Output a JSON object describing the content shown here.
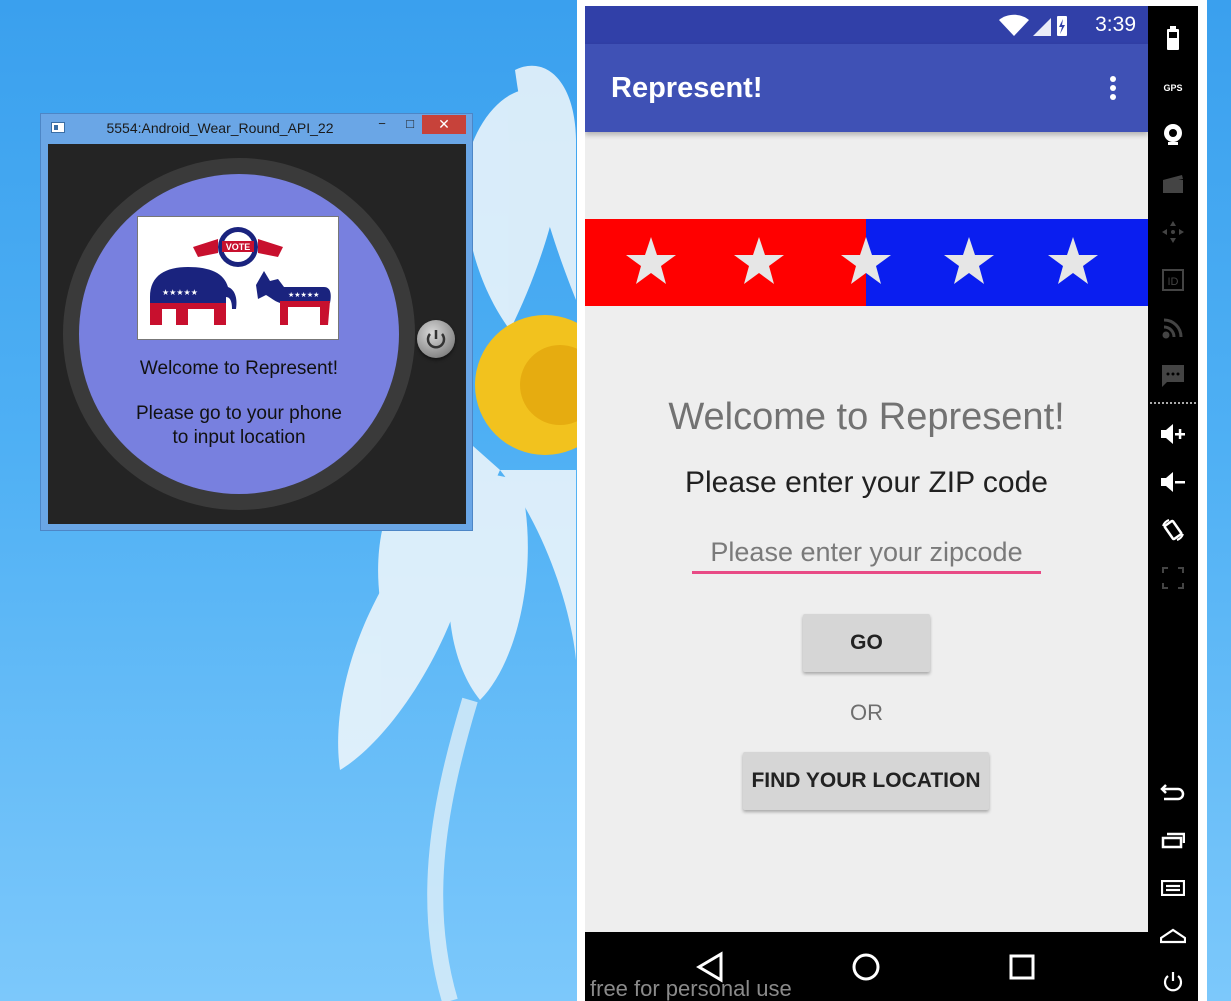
{
  "wear_window": {
    "title": "5554:Android_Wear_Round_API_22",
    "minimize_glyph": "−",
    "maximize_glyph": "□",
    "close_glyph": "✕",
    "watch": {
      "welcome": "Welcome to Represent!",
      "message": "Please go to your phone to input location"
    }
  },
  "phone": {
    "status_bar": {
      "time": "3:39"
    },
    "app_bar": {
      "title": "Represent!"
    },
    "main": {
      "welcome": "Welcome to Represent!",
      "zip_prompt": "Please enter your ZIP code",
      "zip_input": {
        "value": "",
        "placeholder": "Please enter your zipcode"
      },
      "go_label": "GO",
      "or_label": "OR",
      "find_label": "FIND YOUR LOCATION"
    },
    "watermark": "free for personal use"
  },
  "colors": {
    "app_bar": "#3f51b5",
    "status_bar": "#3140a8",
    "accent": "#e84a85",
    "flag_red": "#ff0000",
    "flag_blue": "#0a1ef0",
    "watch_face": "#7880df"
  },
  "side_toolbar": {
    "icons": [
      "battery-icon",
      "gps-icon",
      "camera-icon",
      "video-icon",
      "dpad-icon",
      "id-icon",
      "rss-icon",
      "sms-icon",
      "volume-up-icon",
      "volume-down-icon",
      "rotate-icon",
      "scale-icon",
      "back-icon",
      "recents-icon",
      "menu-icon",
      "home-icon",
      "power-icon"
    ],
    "gps_label": "GPS"
  }
}
